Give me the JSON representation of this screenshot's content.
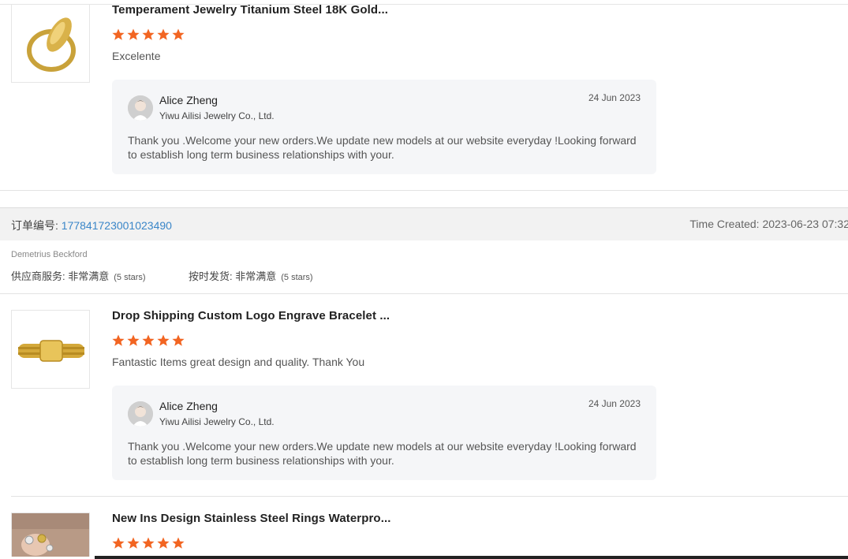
{
  "reviews": [
    {
      "title": "Temperament Jewelry Titanium Steel 18K Gold...",
      "comment": "Excelente",
      "reply": {
        "name": "Alice Zheng",
        "company": "Yiwu Ailisi Jewelry Co., Ltd.",
        "date": "24 Jun 2023",
        "text": "Thank you .Welcome your new orders.We update new models at our website everyday !Looking forward to establish long term business relationships with your."
      }
    },
    {
      "title": "Drop Shipping Custom Logo Engrave Bracelet ...",
      "comment": "Fantastic Items great design and quality. Thank You",
      "reply": {
        "name": "Alice Zheng",
        "company": "Yiwu Ailisi Jewelry Co., Ltd.",
        "date": "24 Jun 2023",
        "text": "Thank you .Welcome your new orders.We update new models at our website everyday !Looking forward to establish long term business relationships with your."
      }
    },
    {
      "title": "New Ins Design Stainless Steel Rings Waterpro..."
    }
  ],
  "order": {
    "label": "订单编号: ",
    "id": "177841723001023490",
    "time_created": "Time Created: 2023-06-23 07:32"
  },
  "buyer": {
    "name": "Demetrius Beckford",
    "supplier_service_label": "供应商服务: ",
    "supplier_service_value": "非常满意",
    "supplier_service_stars": "(5 stars)",
    "ontime_label": "按时发货: ",
    "ontime_value": "非常满意",
    "ontime_stars": "(5 stars)"
  },
  "colors": {
    "star": "#f26522",
    "link": "#3a86c8",
    "reply_bg": "#f5f6f8"
  }
}
